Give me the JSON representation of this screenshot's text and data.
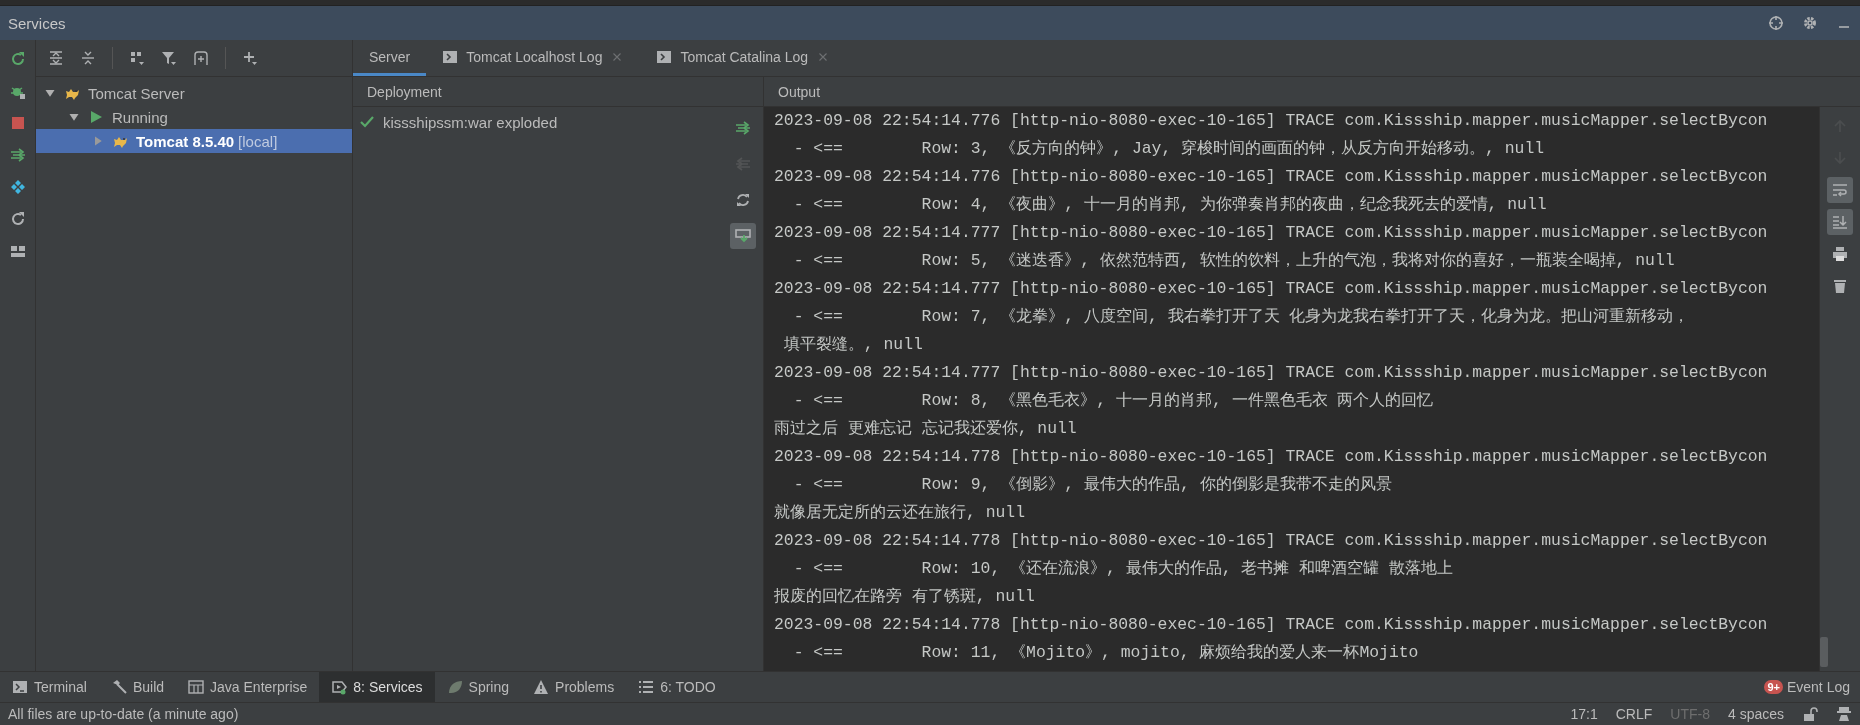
{
  "window": {
    "title": "Services"
  },
  "tree": [
    {
      "label": "Tomcat Server",
      "kind": "server",
      "expanded": true,
      "selected": false,
      "children": [
        {
          "label": "Running",
          "kind": "status",
          "expanded": true,
          "selected": false,
          "children": [
            {
              "label": "Tomcat 8.5.40",
              "suffix": "[local]",
              "kind": "instance",
              "expanded": false,
              "selected": true
            }
          ]
        }
      ]
    }
  ],
  "tabs": [
    {
      "label": "Server",
      "kind": "plain",
      "selected": true
    },
    {
      "label": "Tomcat Localhost Log",
      "kind": "log",
      "selected": false
    },
    {
      "label": "Tomcat Catalina Log",
      "kind": "log",
      "selected": false
    }
  ],
  "deployment": {
    "header": "Deployment",
    "items": [
      {
        "label": "kissshipssm:war exploded",
        "deployed": true
      }
    ],
    "actions": [
      {
        "kind": "deploy",
        "disabled": false,
        "on": false
      },
      {
        "kind": "undeploy",
        "disabled": true,
        "on": false
      },
      {
        "kind": "refresh",
        "disabled": false,
        "on": false
      },
      {
        "kind": "download",
        "disabled": false,
        "on": true
      }
    ]
  },
  "output": {
    "header": "Output",
    "lines": [
      "2023-09-08 22:54:14.776 [http-nio-8080-exec-10-165] TRACE com.Kissship.mapper.musicMapper.selectBycon",
      "  - <==        Row: 3, 《反方向的钟》, Jay, 穿梭时间的画面的钟，从反方向开始移动。, null",
      "2023-09-08 22:54:14.776 [http-nio-8080-exec-10-165] TRACE com.Kissship.mapper.musicMapper.selectBycon",
      "  - <==        Row: 4, 《夜曲》, 十一月的肖邦, 为你弹奏肖邦的夜曲，纪念我死去的爱情, null",
      "2023-09-08 22:54:14.777 [http-nio-8080-exec-10-165] TRACE com.Kissship.mapper.musicMapper.selectBycon",
      "  - <==        Row: 5, 《迷迭香》, 依然范特西, 软性的饮料，上升的气泡，我将对你的喜好，一瓶装全喝掉, null",
      "2023-09-08 22:54:14.777 [http-nio-8080-exec-10-165] TRACE com.Kissship.mapper.musicMapper.selectBycon",
      "  - <==        Row: 7, 《龙拳》, 八度空间, 我右拳打开了天 化身为龙我右拳打开了天，化身为龙。把山河重新移动，",
      " 填平裂缝。, null",
      "2023-09-08 22:54:14.777 [http-nio-8080-exec-10-165] TRACE com.Kissship.mapper.musicMapper.selectBycon",
      "  - <==        Row: 8, 《黑色毛衣》, 十一月的肖邦, 一件黑色毛衣 两个人的回忆",
      "雨过之后 更难忘记 忘记我还爱你, null",
      "2023-09-08 22:54:14.778 [http-nio-8080-exec-10-165] TRACE com.Kissship.mapper.musicMapper.selectBycon",
      "  - <==        Row: 9, 《倒影》, 最伟大的作品, 你的倒影是我带不走的风景",
      "就像居无定所的云还在旅行, null",
      "2023-09-08 22:54:14.778 [http-nio-8080-exec-10-165] TRACE com.Kissship.mapper.musicMapper.selectBycon",
      "  - <==        Row: 10, 《还在流浪》, 最伟大的作品, 老书摊 和啤酒空罐 散落地上",
      "报废的回忆在路旁 有了锈斑, null",
      "2023-09-08 22:54:14.778 [http-nio-8080-exec-10-165] TRACE com.Kissship.mapper.musicMapper.selectBycon",
      "  - <==        Row: 11, 《Mojito》, mojito, 麻烦给我的爱人来一杯Mojito"
    ],
    "actions": [
      {
        "kind": "up",
        "disabled": true,
        "on": false
      },
      {
        "kind": "down",
        "disabled": true,
        "on": false
      },
      {
        "kind": "wrap",
        "disabled": false,
        "on": true
      },
      {
        "kind": "scroll-end",
        "disabled": false,
        "on": true
      },
      {
        "kind": "print",
        "disabled": false,
        "on": false
      },
      {
        "kind": "trash",
        "disabled": false,
        "on": false
      }
    ]
  },
  "tool_tabs": [
    {
      "label": "Terminal",
      "kind": "terminal",
      "selected": false
    },
    {
      "label": "Build",
      "kind": "build",
      "selected": false
    },
    {
      "label": "Java Enterprise",
      "kind": "enterprise",
      "selected": false
    },
    {
      "label": "8: Services",
      "kind": "services",
      "selected": true
    },
    {
      "label": "Spring",
      "kind": "spring",
      "selected": false
    },
    {
      "label": "Problems",
      "kind": "problems",
      "selected": false
    },
    {
      "label": "6: TODO",
      "kind": "todo",
      "selected": false
    }
  ],
  "event_log": {
    "label": "Event Log",
    "badge": "9+"
  },
  "status_bar": {
    "message": "All files are up-to-date (a minute ago)",
    "items": [
      {
        "text": "17:1",
        "disabled": false
      },
      {
        "text": "CRLF",
        "disabled": false
      },
      {
        "text": "UTF-8",
        "disabled": true
      },
      {
        "text": "4 spaces",
        "disabled": false
      }
    ]
  }
}
